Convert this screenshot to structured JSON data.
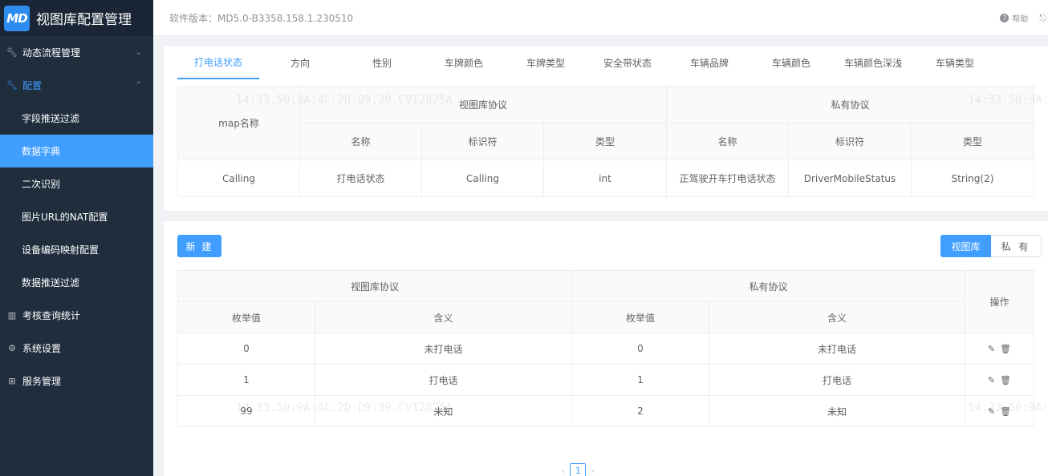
{
  "app": {
    "logo_text": "MD",
    "title": "视图库配置管理"
  },
  "header": {
    "version": "软件版本：MD5.0-B3358.158.1.230510",
    "help": "帮助"
  },
  "sidebar": {
    "items": [
      {
        "label": "动态流程管理",
        "icon": "wrench-icon"
      },
      {
        "label": "配置",
        "icon": "wrench-icon"
      },
      {
        "label": "考核查询统计",
        "icon": "bar-chart-icon"
      },
      {
        "label": "系统设置",
        "icon": "gear-icon"
      },
      {
        "label": "服务管理",
        "icon": "grid-icon"
      }
    ],
    "sub_items": [
      "字段推送过滤",
      "数据字典",
      "二次识别",
      "图片URL的NAT配置",
      "设备编码映射配置",
      "数据推送过滤"
    ]
  },
  "tabs": [
    "打电话状态",
    "方向",
    "性别",
    "车牌颜色",
    "车牌类型",
    "安全带状态",
    "车辆品牌",
    "车辆颜色",
    "车辆颜色深浅",
    "车辆类型"
  ],
  "mapping_table": {
    "map_name_header": "map名称",
    "group_view": "视图库协议",
    "group_private": "私有协议",
    "sub_headers": [
      "名称",
      "标识符",
      "类型",
      "名称",
      "标识符",
      "类型"
    ],
    "row": [
      "Calling",
      "打电话状态",
      "Calling",
      "int",
      "正驾驶开车打电话状态",
      "DriverMobileStatus",
      "String(2)"
    ]
  },
  "toolbar": {
    "new_button": "新 建",
    "seg_view": "视图库",
    "seg_private": "私 有"
  },
  "enum_table": {
    "group_view": "视图库协议",
    "group_private": "私有协议",
    "ops_header": "操作",
    "sub_headers": [
      "枚举值",
      "含义",
      "枚举值",
      "含义"
    ],
    "rows": [
      [
        "0",
        "未打电话",
        "0",
        "未打电话"
      ],
      [
        "1",
        "打电话",
        "1",
        "打电话"
      ],
      [
        "99",
        "未知",
        "2",
        "未知"
      ]
    ]
  },
  "pagination": {
    "current": "1"
  },
  "watermark": {
    "text": "14:33.50:9A:4C:2D:D9:39.CV12825A"
  }
}
